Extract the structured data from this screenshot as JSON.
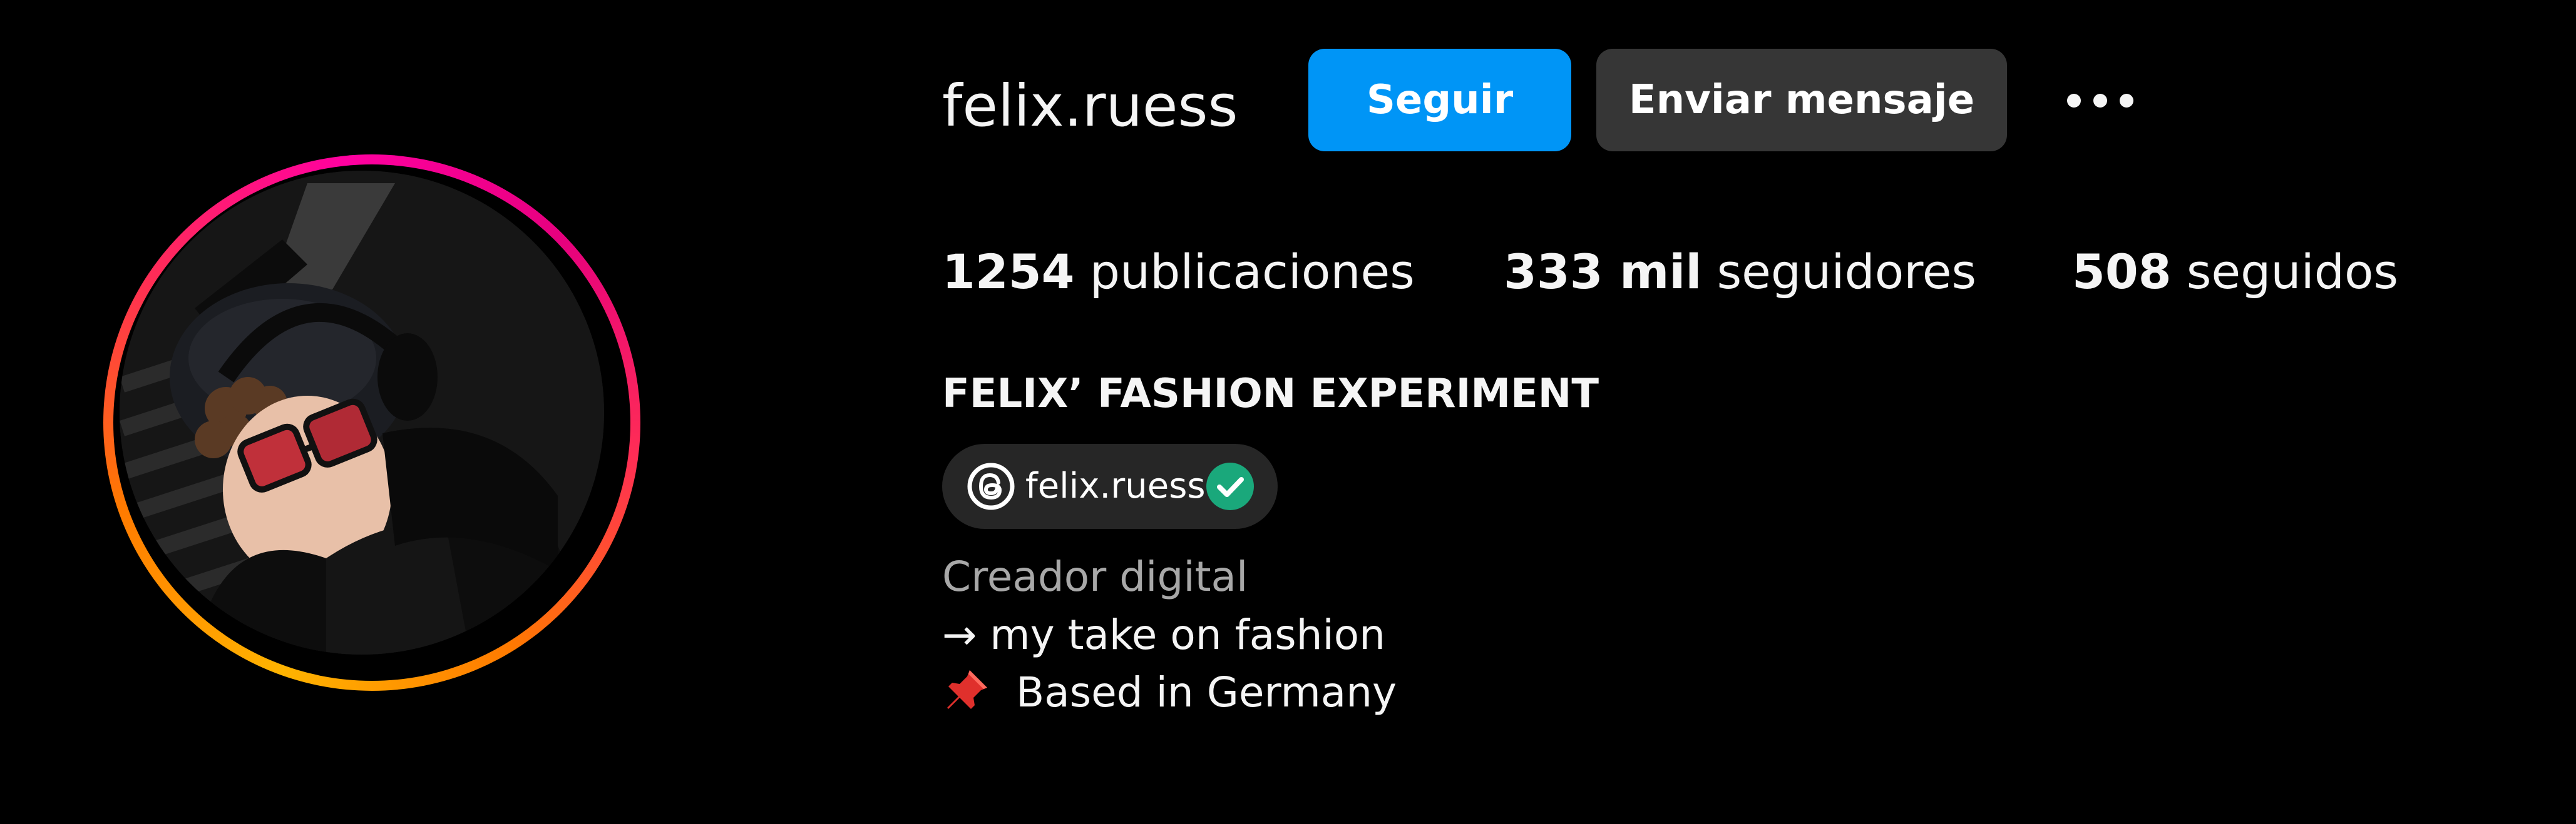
{
  "profile": {
    "username": "felix.ruess",
    "avatar_icon": "profile-photo",
    "story_ring_colors": [
      "#ffb400",
      "#ff7a00",
      "#ff2d55",
      "#ff00a0"
    ]
  },
  "actions": {
    "follow_label": "Seguir",
    "message_label": "Enviar mensaje",
    "more_icon": "more-horizontal-icon"
  },
  "stats": {
    "posts": {
      "count": "1254",
      "label": "publicaciones"
    },
    "followers": {
      "count": "333 mil",
      "label": "seguidores"
    },
    "following": {
      "count": "508",
      "label": "seguidos"
    }
  },
  "bio": {
    "full_name": "FELIX’ FASHION EXPERIMENT",
    "threads": {
      "handle": "felix.ruess",
      "icon": "threads-icon",
      "verified_icon": "verified-check-icon"
    },
    "category": "Creador digital",
    "line1": "→ my take on fashion",
    "line2_icon": "pushpin-icon",
    "line2": "Based in Germany"
  },
  "colors": {
    "background": "#000000",
    "primary_button": "#0095f6",
    "secondary_button": "#363636",
    "chip_background": "#262626",
    "verified": "#1aa87b",
    "secondary_text": "#a8a8a8"
  }
}
